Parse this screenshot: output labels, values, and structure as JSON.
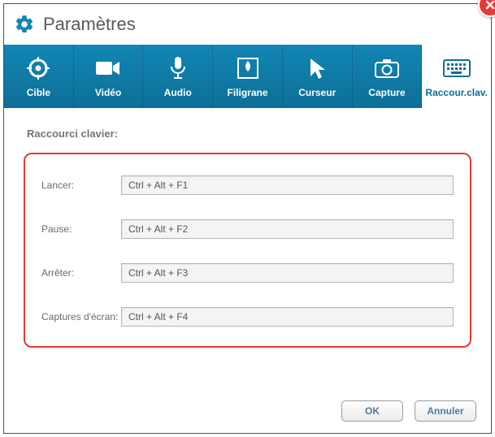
{
  "window": {
    "title": "Paramètres"
  },
  "tabs": {
    "items": [
      {
        "label": "Cible"
      },
      {
        "label": "Vidéo"
      },
      {
        "label": "Audio"
      },
      {
        "label": "Filigrane"
      },
      {
        "label": "Curseur"
      },
      {
        "label": "Capture"
      },
      {
        "label": "Raccour.clav."
      }
    ],
    "activeIndex": 6
  },
  "section": {
    "title": "Raccourci clavier:",
    "rows": [
      {
        "label": "Lancer:",
        "value": "Ctrl + Alt + F1"
      },
      {
        "label": "Pause:",
        "value": "Ctrl + Alt + F2"
      },
      {
        "label": "Arrêter:",
        "value": "Ctrl + Alt + F3"
      },
      {
        "label": "Captures d'écran:",
        "value": "Ctrl + Alt + F4"
      }
    ]
  },
  "footer": {
    "ok": "OK",
    "cancel": "Annuler"
  }
}
